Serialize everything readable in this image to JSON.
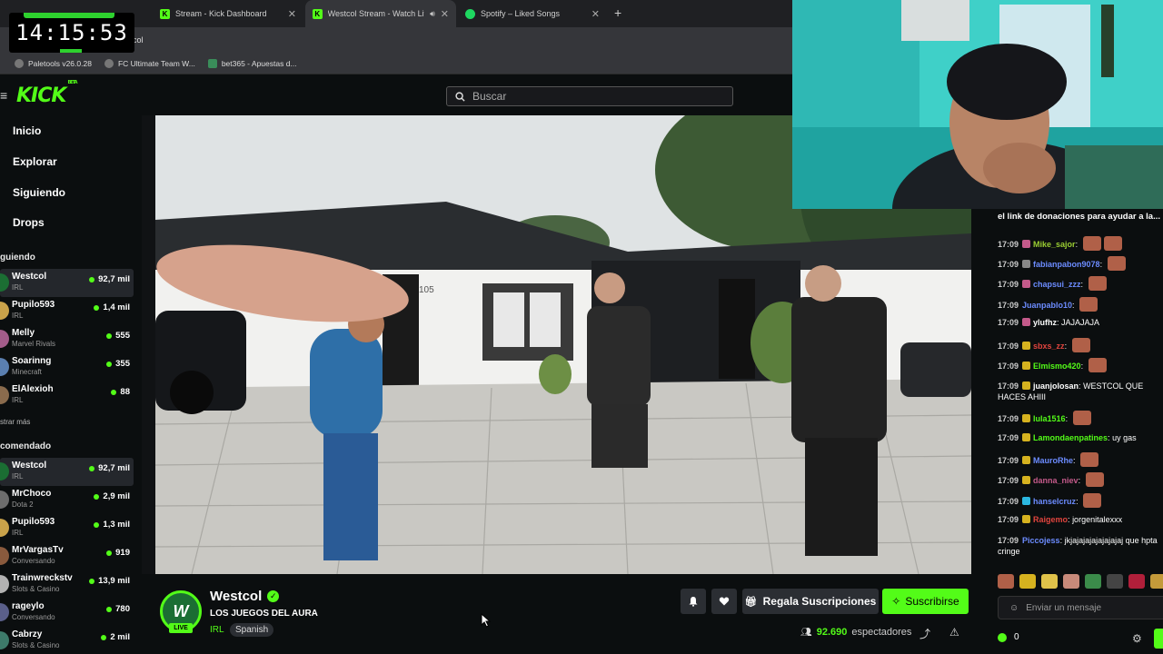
{
  "clock": {
    "time": "14:15:53"
  },
  "browser": {
    "tabs": [
      {
        "label": "Stream - Kick Dashboard"
      },
      {
        "label": "Westcol Stream - Watch Live"
      },
      {
        "label": "Spotify – Liked Songs"
      }
    ],
    "url": "col",
    "bookmarks": [
      {
        "label": "Paletools v26.0.28"
      },
      {
        "label": "FC Ultimate Team W..."
      },
      {
        "label": "bet365 - Apuestas d..."
      }
    ]
  },
  "header": {
    "search_placeholder": "Buscar"
  },
  "sidebar": {
    "nav": [
      "Inicio",
      "Explorar",
      "Siguiendo",
      "Drops"
    ],
    "following_title": "guiendo",
    "following": [
      {
        "name": "Westcol",
        "cat": "IRL",
        "count": "92,7 mil"
      },
      {
        "name": "Pupilo593",
        "cat": "IRL",
        "count": "1,4 mil"
      },
      {
        "name": "Melly",
        "cat": "Marvel Rivals",
        "count": "555"
      },
      {
        "name": "Soarinng",
        "cat": "Minecraft",
        "count": "355"
      },
      {
        "name": "ElAlexioh",
        "cat": "IRL",
        "count": "88"
      }
    ],
    "show_more": "strar más",
    "recommended_title": "comendado",
    "recommended": [
      {
        "name": "Westcol",
        "cat": "IRL",
        "count": "92,7 mil"
      },
      {
        "name": "MrChoco",
        "cat": "Dota 2",
        "count": "2,9 mil"
      },
      {
        "name": "Pupilo593",
        "cat": "IRL",
        "count": "1,3 mil"
      },
      {
        "name": "MrVargasTv",
        "cat": "Conversando",
        "count": "919"
      },
      {
        "name": "Trainwreckstv",
        "cat": "Slots & Casino",
        "count": "13,9 mil"
      },
      {
        "name": "rageylo",
        "cat": "Conversando",
        "count": "780"
      },
      {
        "name": "Cabrzy",
        "cat": "Slots & Casino",
        "count": "2 mil"
      }
    ]
  },
  "stream": {
    "streamer": "Westcol",
    "title": "LOS JUEGOS DEL AURA",
    "category": "IRL",
    "language": "Spanish",
    "live_badge": "LIVE",
    "gift_label": "Regala Suscripciones",
    "subscribe_label": "Suscribirse",
    "viewers": "92.690",
    "viewers_label": "espectadores"
  },
  "chat": {
    "header": "el link de donaciones para ayudar a la...",
    "messages": [
      {
        "time": "17:09",
        "user": "Mike_sajor",
        "color": "#9acd32",
        "badge": "#c45a8a",
        "text": "",
        "emotes": 2
      },
      {
        "time": "17:09",
        "user": "fabianpabon9078",
        "color": "#6c8cff",
        "badge": "#888888",
        "text": "",
        "emotes": 1
      },
      {
        "time": "17:09",
        "user": "chapsui_zzz",
        "color": "#6c8cff",
        "badge": "#c45a8a",
        "text": "",
        "emotes": 1
      },
      {
        "time": "17:09",
        "user": "Juanpablo10",
        "color": "#6c8cff",
        "badge": "",
        "text": "",
        "emotes": 1
      },
      {
        "time": "17:09",
        "user": "ylufhz",
        "color": "#ffffff",
        "badge": "#c45a8a",
        "text": "JAJAJAJA",
        "emotes": 0
      },
      {
        "time": "17:09",
        "user": "sbxs_zz",
        "color": "#e0443e",
        "badge": "#d6b21f",
        "text": "",
        "emotes": 1
      },
      {
        "time": "17:09",
        "user": "Elmismo420",
        "color": "#53fc18",
        "badge": "#d6b21f",
        "text": "",
        "emotes": 1
      },
      {
        "time": "17:09",
        "user": "juanjolosan",
        "color": "#ffffff",
        "badge": "#d6b21f",
        "text": "WESTCOL QUE HACES AHIII",
        "emotes": 0
      },
      {
        "time": "17:09",
        "user": "lula1516",
        "color": "#53fc18",
        "badge": "#d6b21f",
        "text": "",
        "emotes": 1
      },
      {
        "time": "17:09",
        "user": "Lamondaenpatines",
        "color": "#53fc18",
        "badge": "#d6b21f",
        "text": "uy gas",
        "emotes": 0
      },
      {
        "time": "17:09",
        "user": "MauroRhe",
        "color": "#6c8cff",
        "badge": "#d6b21f",
        "text": "",
        "emotes": 1
      },
      {
        "time": "17:09",
        "user": "danna_niev",
        "color": "#c45a8a",
        "badge": "#d6b21f",
        "text": "",
        "emotes": 1
      },
      {
        "time": "17:09",
        "user": "hanselcruz",
        "color": "#6c8cff",
        "badge": "#2bb7e0",
        "text": "",
        "emotes": 1
      },
      {
        "time": "17:09",
        "user": "Raigemo",
        "color": "#e0443e",
        "badge": "#d6b21f",
        "text": "jorgenitalexxx",
        "emotes": 0
      },
      {
        "time": "17:09",
        "user": "Piccojess",
        "color": "#6c8cff",
        "badge": "",
        "text": "jkjajajajajajajajaj que hpta cringe",
        "emotes": 0
      }
    ],
    "input_placeholder": "Enviar un mensaje",
    "points": "0"
  }
}
